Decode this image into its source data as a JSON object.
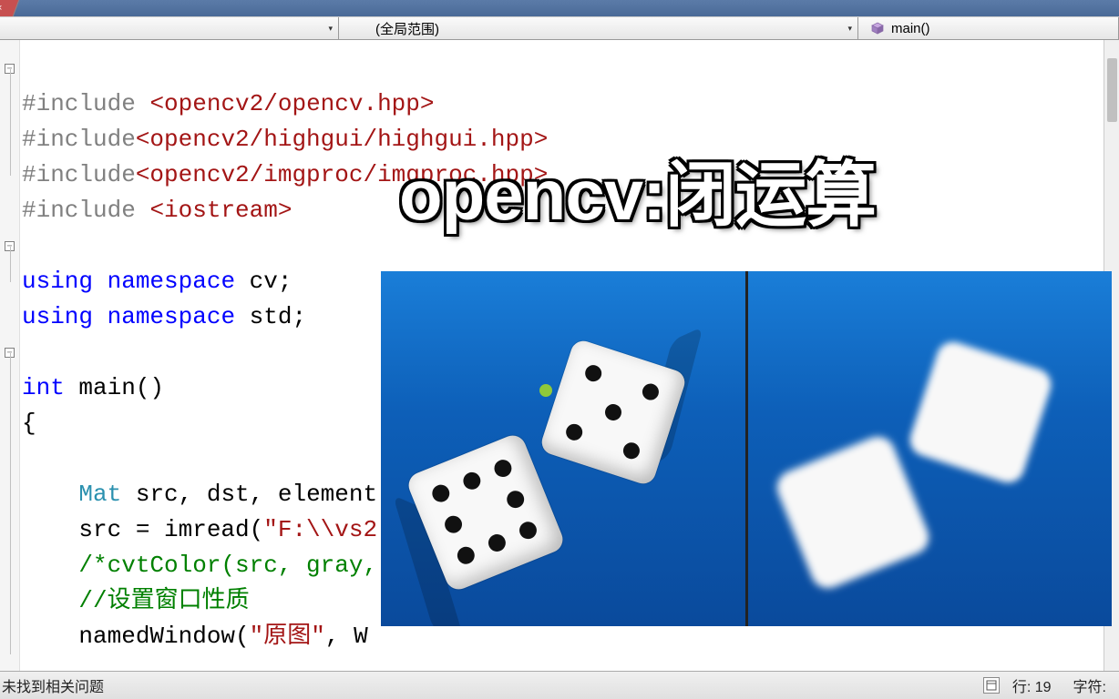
{
  "topbar": {
    "close_x": "×"
  },
  "toolbar": {
    "dd1_value": "",
    "dd2_value": "(全局范围)",
    "dd3_value": "main()"
  },
  "overlay": {
    "title": "opencv:闭运算"
  },
  "code": {
    "l1_pre": "#include ",
    "l1_inc": "<opencv2/opencv.hpp>",
    "l2_pre": "#include",
    "l2_inc": "<opencv2/highgui/highgui.hpp>",
    "l3_pre": "#include",
    "l3_inc": "<opencv2/imgproc/imgproc.hpp>",
    "l4_pre": "#include ",
    "l4_inc": "<iostream>",
    "l6_kw1": "using",
    "l6_kw2": "namespace",
    "l6_ns": "cv",
    "l6_semi": ";",
    "l7_kw1": "using",
    "l7_kw2": "namespace",
    "l7_ns": "std",
    "l7_semi": ";",
    "l9_kw": "int",
    "l9_fn": " main()",
    "l10": "{",
    "l12_cls": "Mat",
    "l12_rest": " src, dst, element",
    "l13_a": "    src = imread(",
    "l13_str": "\"F:\\\\vs2",
    "l13_rest": "",
    "l14_cmt": "    /*cvtColor(src, gray,",
    "l15_cmt": "    //设置窗口性质",
    "l16_a": "    namedWindow(",
    "l16_str": "\"原图\"",
    "l16_rest": ", W"
  },
  "fold": {
    "minus": "−"
  },
  "statusbar": {
    "left": "未找到相关问题",
    "line_label": "行:",
    "line_value": "19",
    "char_label": "字符:"
  },
  "icons": {
    "cube_color": "#b090d0"
  }
}
